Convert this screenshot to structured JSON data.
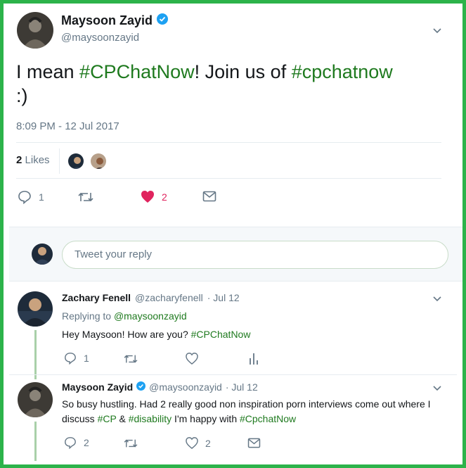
{
  "tweet": {
    "author_name": "Maysoon Zayid",
    "author_handle": "@maysoonzayid",
    "text_parts": [
      "I mean ",
      "#CPChatNow",
      "! Join us of ",
      "#cpchatnow",
      " :)"
    ],
    "timestamp": "8:09 PM - 12 Jul 2017",
    "likes_count": "2",
    "likes_label": "Likes",
    "reply_count": "1",
    "like_count": "2"
  },
  "reply_box": {
    "placeholder": "Tweet your reply"
  },
  "replies": [
    {
      "author_name": "Zachary Fenell",
      "author_handle": "@zacharyfenell",
      "date": "· Jul 12",
      "replying_to_label": "Replying to",
      "replying_to_handle": "@maysoonzayid",
      "text_parts": [
        "Hey Maysoon! How are you? ",
        "#CPChatNow"
      ],
      "reply_count": "1"
    },
    {
      "author_name": "Maysoon Zayid",
      "author_handle": "@maysoonzayid",
      "date": "· Jul 12",
      "text_parts": [
        "So busy hustling. Had 2 really good non inspiration porn interviews come out where I discuss ",
        "#CP",
        " & ",
        "#disability",
        " I'm happy with ",
        "#CpchatNow"
      ],
      "reply_count": "2",
      "like_count": "2"
    }
  ],
  "colors": {
    "frame_border": "#2cb34a",
    "hashtag": "#1f7a1f",
    "verified": "#1da1f2",
    "heart": "#e0245e",
    "muted": "#657786"
  }
}
